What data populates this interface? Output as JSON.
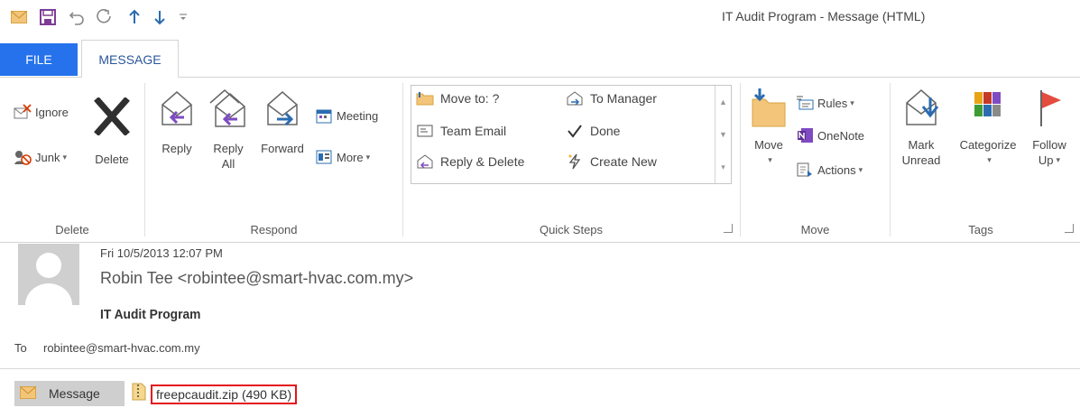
{
  "window": {
    "title": "IT Audit Program - Message (HTML)"
  },
  "tabs": [
    {
      "label": "FILE"
    },
    {
      "label": "MESSAGE"
    }
  ],
  "ribbon": {
    "delete_group": {
      "label": "Delete",
      "ignore": "Ignore",
      "junk": "Junk",
      "delete": "Delete"
    },
    "respond_group": {
      "label": "Respond",
      "reply": "Reply",
      "reply_all_1": "Reply",
      "reply_all_2": "All",
      "forward": "Forward",
      "meeting": "Meeting",
      "more": "More"
    },
    "quick_steps": {
      "label": "Quick Steps",
      "items": [
        {
          "label": "Move to: ?"
        },
        {
          "label": "Team Email"
        },
        {
          "label": "Reply & Delete"
        },
        {
          "label": "To Manager"
        },
        {
          "label": "Done"
        },
        {
          "label": "Create New"
        }
      ]
    },
    "move_group": {
      "label": "Move",
      "move": "Move",
      "rules": "Rules",
      "onenote": "OneNote",
      "actions": "Actions"
    },
    "tags_group": {
      "label": "Tags",
      "mark_unread_1": "Mark",
      "mark_unread_2": "Unread",
      "categorize": "Categorize",
      "follow_up_1": "Follow",
      "follow_up_2": "Up"
    }
  },
  "message": {
    "date": "Fri 10/5/2013 12:07 PM",
    "sender": "Robin Tee <robintee@smart-hvac.com.my>",
    "subject": "IT Audit Program",
    "to_label": "To",
    "to_value": "robintee@smart-hvac.com.my",
    "attachments": {
      "message_tab": "Message",
      "file": "freepcaudit.zip (490 KB)"
    }
  },
  "colors": {
    "accent": "#2672ec",
    "highlight_border": "#e4141b"
  }
}
